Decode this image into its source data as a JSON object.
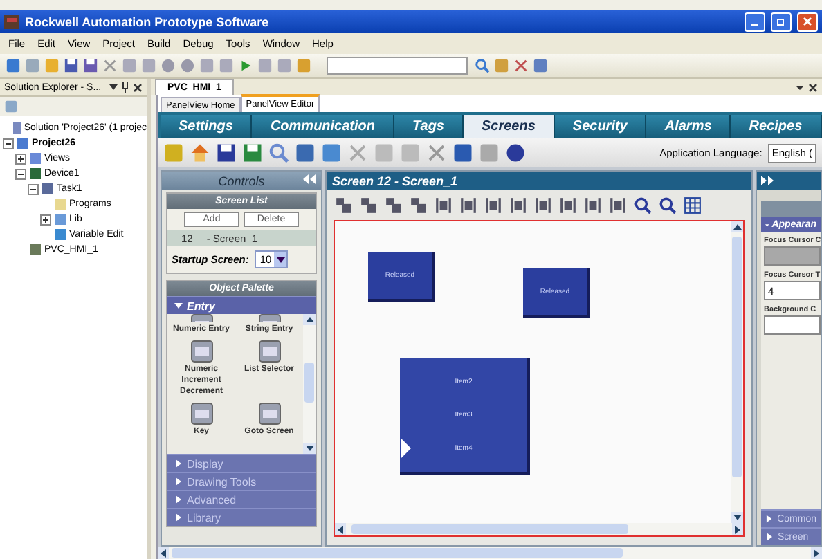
{
  "window": {
    "title": "Rockwell Automation Prototype Software"
  },
  "menu": [
    "File",
    "Edit",
    "View",
    "Project",
    "Build",
    "Debug",
    "Tools",
    "Window",
    "Help"
  ],
  "solution_explorer": {
    "title": "Solution Explorer - S...",
    "tree": [
      {
        "label": "Solution 'Project26' (1 projec",
        "kind": "solution"
      },
      {
        "label": "Project26",
        "kind": "project",
        "expanded": true,
        "children": [
          {
            "label": "Views",
            "kind": "views",
            "expanded": false
          },
          {
            "label": "Device1",
            "kind": "device",
            "expanded": true,
            "children": [
              {
                "label": "Task1",
                "kind": "task",
                "expanded": true,
                "children": [
                  {
                    "label": "Programs",
                    "kind": "folder"
                  },
                  {
                    "label": "Lib",
                    "kind": "lib",
                    "expanded": false
                  },
                  {
                    "label": "Variable Edit",
                    "kind": "variables"
                  }
                ]
              }
            ]
          },
          {
            "label": "PVC_HMI_1",
            "kind": "hmi"
          }
        ]
      }
    ]
  },
  "document_tab": "PVC_HMI_1",
  "editor_tabs": [
    {
      "label": "PanelView Home",
      "selected": false
    },
    {
      "label": "PanelView Editor",
      "selected": true
    }
  ],
  "ribbon_tabs": [
    {
      "label": "Settings",
      "selected": false
    },
    {
      "label": "Communication",
      "selected": false
    },
    {
      "label": "Tags",
      "selected": false
    },
    {
      "label": "Screens",
      "selected": true
    },
    {
      "label": "Security",
      "selected": false
    },
    {
      "label": "Alarms",
      "selected": false
    },
    {
      "label": "Recipes",
      "selected": false
    }
  ],
  "application_language": {
    "label": "Application Language:",
    "value": "English ("
  },
  "controls": {
    "title": "Controls",
    "screen_list": {
      "title": "Screen List",
      "buttons": [
        "Add",
        "Delete"
      ],
      "rows": [
        {
          "number": "12",
          "name": "- Screen_1",
          "selected": true
        }
      ],
      "startup_label": "Startup Screen:",
      "startup_value": "10"
    },
    "object_palette": {
      "title": "Object Palette",
      "sections": [
        {
          "label": "Entry",
          "expanded": true,
          "items": [
            "Numeric Entry",
            "String Entry",
            "Numeric Increment Decrement",
            "List Selector",
            "Key",
            "Goto Screen"
          ]
        },
        {
          "label": "Display",
          "expanded": false
        },
        {
          "label": "Drawing Tools",
          "expanded": false
        },
        {
          "label": "Advanced",
          "expanded": false
        },
        {
          "label": "Library",
          "expanded": false
        }
      ]
    }
  },
  "screen_editor": {
    "title": "Screen 12 - Screen_1",
    "objects": [
      {
        "kind": "button",
        "label": "Released"
      },
      {
        "kind": "button",
        "label": "Released"
      },
      {
        "kind": "list",
        "items": [
          {
            "label": "Item2",
            "selected": false
          },
          {
            "label": "Item3",
            "selected": false
          },
          {
            "label": "Item4",
            "selected": true
          }
        ]
      }
    ]
  },
  "properties": {
    "section": "Appearan",
    "fields": [
      {
        "label": "Focus Cursor C",
        "kind": "swatch",
        "color": "#a8a8a8"
      },
      {
        "label": "Focus Cursor T",
        "kind": "text",
        "value": "4"
      },
      {
        "label": "Background C",
        "kind": "swatch",
        "color": "#ffffff"
      }
    ],
    "sections": [
      "Common",
      "Screen"
    ]
  }
}
